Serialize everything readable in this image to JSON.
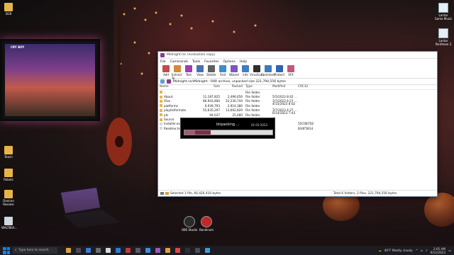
{
  "desktop": {
    "left_icons": [
      {
        "label": "DCB",
        "kind": "folder"
      },
      {
        "label": "Teach",
        "kind": "folder"
      },
      {
        "label": "Robots",
        "kind": "folder"
      },
      {
        "label": "Daniron Resolve",
        "kind": "folder"
      },
      {
        "label": "WALTBSA...",
        "kind": "bin"
      }
    ],
    "right_icons": [
      {
        "label": "Lantar Game Music",
        "kind": "doc"
      },
      {
        "label": "Lantar Pantheon 2",
        "kind": "doc"
      }
    ],
    "dock_apps": [
      {
        "label": "OBS Studio",
        "color": "#2b2b2b"
      },
      {
        "label": "Bandicam",
        "color": "#c0282a"
      }
    ],
    "crt_hud": "CRY BOY"
  },
  "window": {
    "title": "Midnight.rar (evaluation copy)",
    "menu": [
      "File",
      "Commands",
      "Tools",
      "Favorites",
      "Options",
      "Help"
    ],
    "toolbar": [
      {
        "label": "Add",
        "icon": "add-icon",
        "color": "#c24b4b"
      },
      {
        "label": "Extract To",
        "icon": "extract-icon",
        "color": "#d28a3c"
      },
      {
        "label": "Test",
        "icon": "test-icon",
        "color": "#9c3fb0"
      },
      {
        "label": "View",
        "icon": "view-icon",
        "color": "#4a6fb5"
      },
      {
        "label": "Delete",
        "icon": "delete-icon",
        "color": "#5e5e5e"
      },
      {
        "label": "Find",
        "icon": "find-icon",
        "color": "#3b8ec9"
      },
      {
        "label": "Wizard",
        "icon": "wizard-icon",
        "color": "#7c56c2"
      },
      {
        "label": "Info",
        "icon": "info-icon",
        "color": "#3f7cc6"
      },
      {
        "label": "VirusScan",
        "icon": "virusscan-icon",
        "color": "#2f2f2f"
      },
      {
        "label": "Comment",
        "icon": "comment-icon",
        "color": "#3c7bbf"
      },
      {
        "label": "Protect",
        "icon": "protect-icon",
        "color": "#2f63b8"
      },
      {
        "label": "SFX",
        "icon": "sfx-icon",
        "color": "#c2577e"
      }
    ],
    "path": "Midnight.rar\\Midnight - RAR archive, unpacked size 221,794,556 bytes",
    "columns": [
      "Name",
      "Size",
      "Packed",
      "Type",
      "Modified",
      "CRC32"
    ],
    "rows": [
      {
        "name": "..",
        "size": "",
        "packed": "",
        "type": "File folder",
        "modified": "",
        "crc": "",
        "kind": "folder"
      },
      {
        "name": "About",
        "size": "11,187,825",
        "packed": "2,496,656",
        "type": "File folder",
        "modified": "5/5/2023 8:42 ...",
        "crc": "",
        "kind": "folder"
      },
      {
        "name": "Files",
        "size": "86,943,480",
        "packed": "22,230,744",
        "type": "File folder",
        "modified": "3/7/2023 4:27 ...",
        "crc": "",
        "kind": "folder"
      },
      {
        "name": "platforms",
        "size": "6,939,793",
        "packed": "2,914,380",
        "type": "File folder",
        "modified": "4/15/2023 8:02 ...",
        "crc": "",
        "kind": "folder"
      },
      {
        "name": "playlistformats",
        "size": "55,635,297",
        "packed": "13,662,820",
        "type": "File folder",
        "modified": "3/7/2023 4:27 ...",
        "crc": "",
        "kind": "folder"
      },
      {
        "name": "pls",
        "size": "94,037",
        "packed": "25,480",
        "type": "File folder",
        "modified": "6/14/2023 7:43 ...",
        "crc": "",
        "kind": "folder"
      },
      {
        "name": "Source",
        "size": "",
        "packed": "",
        "type": "",
        "modified": "",
        "crc": "",
        "kind": "folder"
      },
      {
        "name": "Installer.exe",
        "size": "",
        "packed": "",
        "type": "",
        "modified": "",
        "crc": "55C0B7D2",
        "kind": "file"
      },
      {
        "name": "Readme.txt",
        "size": "",
        "packed": "",
        "type": "",
        "modified": "",
        "crc": "834F5B14",
        "kind": "file"
      }
    ],
    "status_left": "Selected 1 file, 66,426,416 bytes",
    "status_right": "Total 6 folders, 2 files, 221,794,556 bytes"
  },
  "dialog": {
    "title": "Unpacking ...",
    "timer": "01:03:2023",
    "progress": 0.3,
    "segment": 0.12
  },
  "taskbar": {
    "search_placeholder": "Type here to search",
    "weather": "40°F  Mostly cloudy",
    "time": "2:05 AM",
    "date": "9/12/2023",
    "app_colors": [
      "#e0a13b",
      "#4a4a52",
      "#3b79d8",
      "#6b6b72",
      "#d9d9d9",
      "#2e7bd6",
      "#c23b3b",
      "#5a5a66",
      "#3b8ee0",
      "#9b59b6",
      "#e0a13b",
      "#e04646",
      "#2f2f36",
      "#4c4c56",
      "#3d9be0"
    ]
  }
}
